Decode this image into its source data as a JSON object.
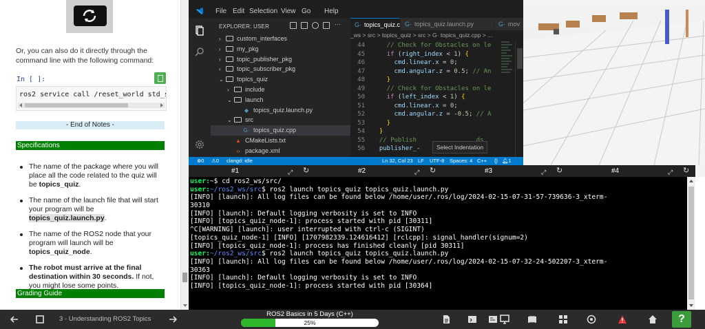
{
  "notebook": {
    "intro": "Or, you can also do it directly through the command line with the following command:",
    "in_label": "In [ ]:",
    "code": "ros2 service call /reset_world std_srvs/srv/Empty",
    "end_notes": "- End of Notes -",
    "specifications_header": "Specifications",
    "spec_items": [
      {
        "pre": "The name of the package where you will place all the code related to the quiz will be ",
        "bold": "topics_quiz",
        "post": "."
      },
      {
        "pre": "The name of the launch file that will start your program will be ",
        "bold": "topics_quiz.launch.py",
        "post": "."
      },
      {
        "pre": "The name of the ROS2 node that your program will launch will be ",
        "bold": "topics_quiz_node",
        "post": "."
      },
      {
        "pre": "",
        "bold": "The robot must arrive at the final destination within 30 seconds.",
        "post": " If not, you might lose some points."
      }
    ],
    "grading_header": "Grading Guide"
  },
  "vscode": {
    "menu": [
      "File",
      "Edit",
      "Selection",
      "View",
      "Go",
      "Help"
    ],
    "explorer_title": "EXPLORER: USER",
    "tree": [
      {
        "label": "custom_interfaces",
        "kind": "folder",
        "depth": 1,
        "open": false
      },
      {
        "label": "my_pkg",
        "kind": "folder",
        "depth": 1,
        "open": false
      },
      {
        "label": "topic_publisher_pkg",
        "kind": "folder",
        "depth": 1,
        "open": false
      },
      {
        "label": "topic_subscriber_pkg",
        "kind": "folder",
        "depth": 1,
        "open": false
      },
      {
        "label": "topics_quiz",
        "kind": "folder",
        "depth": 1,
        "open": true
      },
      {
        "label": "include",
        "kind": "folder",
        "depth": 2,
        "open": false
      },
      {
        "label": "launch",
        "kind": "folder",
        "depth": 2,
        "open": true
      },
      {
        "label": "topics_quiz.launch.py",
        "kind": "launch",
        "depth": 3
      },
      {
        "label": "src",
        "kind": "folder",
        "depth": 2,
        "open": true
      },
      {
        "label": "topics_quiz.cpp",
        "kind": "cpp",
        "depth": 3,
        "selected": true
      },
      {
        "label": "CMakeLists.txt",
        "kind": "cmake",
        "depth": 2
      },
      {
        "label": "package.xml",
        "kind": "xml",
        "depth": 2
      }
    ],
    "tabs": [
      "topics_quiz.cpp",
      "topics_quiz.launch.py",
      "mov"
    ],
    "breadcrumbs": "_ws  >  src  >  topics_quiz  >  src  >  G·  topics_quiz.cpp  >  ...",
    "code_lines": [
      {
        "n": "44",
        "html": "<span class=\"c-com\">    // Check for Obstacles on le</span>"
      },
      {
        "n": "45",
        "html": "<span class=\"c-kw\">    if</span><span class=\"c-pun\"> (</span><span class=\"c-var\">right_index</span><span class=\"c-pun\"> &lt; </span><span class=\"c-num\">1</span><span class=\"c-pun\">) </span><span class=\"c-br\">{</span>"
      },
      {
        "n": "46",
        "html": "<span class=\"c-var\">      cmd</span><span class=\"c-pun\">.</span><span class=\"c-var\">linear</span><span class=\"c-pun\">.</span><span class=\"c-var\">x</span><span class=\"c-pun\"> = </span><span class=\"c-num\">0</span><span class=\"c-pun\">;</span>"
      },
      {
        "n": "47",
        "html": "<span class=\"c-var\">      cmd</span><span class=\"c-pun\">.</span><span class=\"c-var\">angular</span><span class=\"c-pun\">.</span><span class=\"c-var\">z</span><span class=\"c-pun\"> = </span><span class=\"c-num\">0.5</span><span class=\"c-pun\">; </span><span class=\"c-com\">// An</span>"
      },
      {
        "n": "48",
        "html": "<span class=\"c-br\">    }</span>"
      },
      {
        "n": "49",
        "html": "<span class=\"c-com\">    // Check for Obstacles on le</span>"
      },
      {
        "n": "50",
        "html": "<span class=\"c-kw\">    if</span><span class=\"c-pun\"> (</span><span class=\"c-var\">left_index</span><span class=\"c-pun\"> &lt; </span><span class=\"c-num\">1</span><span class=\"c-pun\">) </span><span class=\"c-br\">{</span>"
      },
      {
        "n": "51",
        "html": "<span class=\"c-var\">      cmd</span><span class=\"c-pun\">.</span><span class=\"c-var\">linear</span><span class=\"c-pun\">.</span><span class=\"c-var\">x</span><span class=\"c-pun\"> = </span><span class=\"c-num\">0</span><span class=\"c-pun\">;</span>"
      },
      {
        "n": "52",
        "html": "<span class=\"c-var\">      cmd</span><span class=\"c-pun\">.</span><span class=\"c-var\">angular</span><span class=\"c-pun\">.</span><span class=\"c-var\">z</span><span class=\"c-pun\"> = -</span><span class=\"c-num\">0.5</span><span class=\"c-pun\">; </span><span class=\"c-com\">// A</span>"
      },
      {
        "n": "53",
        "html": "<span class=\"c-br\">    }</span>"
      },
      {
        "n": "54",
        "html": "<span class=\"c-br\">  }</span>"
      },
      {
        "n": "55",
        "html": "<span class=\"c-com\">  // Publish                ds</span>"
      },
      {
        "n": "56",
        "html": "<span class=\"c-var\">  publisher_</span><span class=\"c-pun\">-</span>"
      }
    ],
    "tooltip": "Select Indentation",
    "status": {
      "errors": "0",
      "warnings": "0",
      "clangd": "clangd: idle",
      "position": "Ln 32, Col 23",
      "eol": "LF",
      "encoding": "UTF-8",
      "spaces": "Spaces: 4",
      "language": "C++",
      "notifications": "1"
    }
  },
  "terminal_tabs": [
    "#1",
    "#2",
    "#3",
    "#4"
  ],
  "terminal": [
    [
      {
        "t": "user:",
        "c": "user"
      },
      {
        "t": "~$ cd ros2_ws/src/",
        "c": ""
      }
    ],
    [
      {
        "t": "user:",
        "c": "user"
      },
      {
        "t": "~/ros2_ws/src",
        "c": "path"
      },
      {
        "t": "$ ros2 launch topics_quiz topics_quiz.launch.py",
        "c": ""
      }
    ],
    [
      {
        "t": "[INFO] [launch]: All log files can be found below /home/user/.ros/log/2024-02-15-07-31-57-739636-3_xterm-",
        "c": ""
      }
    ],
    [
      {
        "t": "30310",
        "c": ""
      }
    ],
    [
      {
        "t": "[INFO] [launch]: Default logging verbosity is set to INFO",
        "c": ""
      }
    ],
    [
      {
        "t": "[INFO] [topics_quiz_node-1]: process started with pid [30311]",
        "c": ""
      }
    ],
    [
      {
        "t": "^C[WARNING] [launch]: user interrupted with ctrl-c (SIGINT)",
        "c": ""
      }
    ],
    [
      {
        "t": "[topics_quiz_node-1] [INFO] [1707982339.124616412] [rclcpp]: signal_handler(signum=2)",
        "c": ""
      }
    ],
    [
      {
        "t": "[INFO] [topics_quiz_node-1]: process has finished cleanly [pid 30311]",
        "c": ""
      }
    ],
    [
      {
        "t": "user:",
        "c": "user"
      },
      {
        "t": "~/ros2_ws/src",
        "c": "path"
      },
      {
        "t": "$ ros2 launch topics_quiz topics_quiz.launch.py",
        "c": ""
      }
    ],
    [
      {
        "t": "[INFO] [launch]: All log files can be found below /home/user/.ros/log/2024-02-15-07-32-24-502207-3_xterm-",
        "c": ""
      }
    ],
    [
      {
        "t": "30363",
        "c": ""
      }
    ],
    [
      {
        "t": "[INFO] [launch]: Default logging verbosity is set to INFO",
        "c": ""
      }
    ],
    [
      {
        "t": "[INFO] [topics_quiz_node-1]: process started with pid [30364]",
        "c": ""
      }
    ]
  ],
  "bottom_bar": {
    "course_item": "3 - Understanding ROS2 Topics",
    "course_title": "ROS2 Basics in 5 Days (C++)",
    "progress_text": "25%",
    "progress_value": 0.25,
    "help": "?"
  },
  "colors": {
    "green_header": "#008000",
    "vscode_status": "#007acc",
    "progress_fill": "#2eb82e",
    "terminal_user": "#00ff66"
  }
}
